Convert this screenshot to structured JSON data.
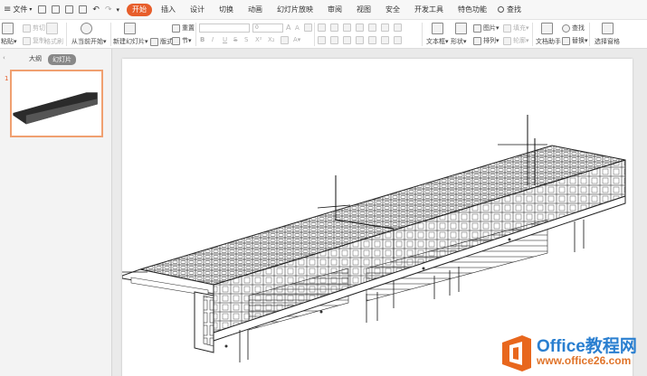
{
  "menu": {
    "file_label": "文件",
    "tabs": [
      {
        "label": "开始",
        "active": true
      },
      {
        "label": "插入",
        "active": false
      },
      {
        "label": "设计",
        "active": false
      },
      {
        "label": "切换",
        "active": false
      },
      {
        "label": "动画",
        "active": false
      },
      {
        "label": "幻灯片放映",
        "active": false
      },
      {
        "label": "审阅",
        "active": false
      },
      {
        "label": "视图",
        "active": false
      },
      {
        "label": "安全",
        "active": false
      },
      {
        "label": "开发工具",
        "active": false
      },
      {
        "label": "特色功能",
        "active": false
      }
    ],
    "search_label": "查找"
  },
  "ribbon": {
    "paste": "粘贴",
    "cut": "剪切",
    "copy": "复制",
    "format_painter": "格式刷",
    "play_from_current": "从当前开始",
    "new_slide": "新建幻灯片",
    "layout": "版式",
    "reset": "重置",
    "section": "节",
    "font_size": "0",
    "text_box": "文本框",
    "shape": "形状",
    "picture": "图片",
    "arrange": "排列",
    "fill": "填充",
    "outline": "轮廓",
    "doc_assistant": "文档助手",
    "find": "查找",
    "replace": "替换",
    "select_pane": "选择窗格"
  },
  "panel": {
    "tabs": [
      {
        "label": "大纲",
        "active": false
      },
      {
        "label": "幻灯片",
        "active": true
      }
    ],
    "slide_number": "1"
  },
  "watermark": {
    "brand": "Office教程网",
    "url": "www.office26.com"
  },
  "colors": {
    "accent": "#e75e2b",
    "watermark_blue": "#2a7fd0",
    "watermark_orange": "#e0742a"
  }
}
